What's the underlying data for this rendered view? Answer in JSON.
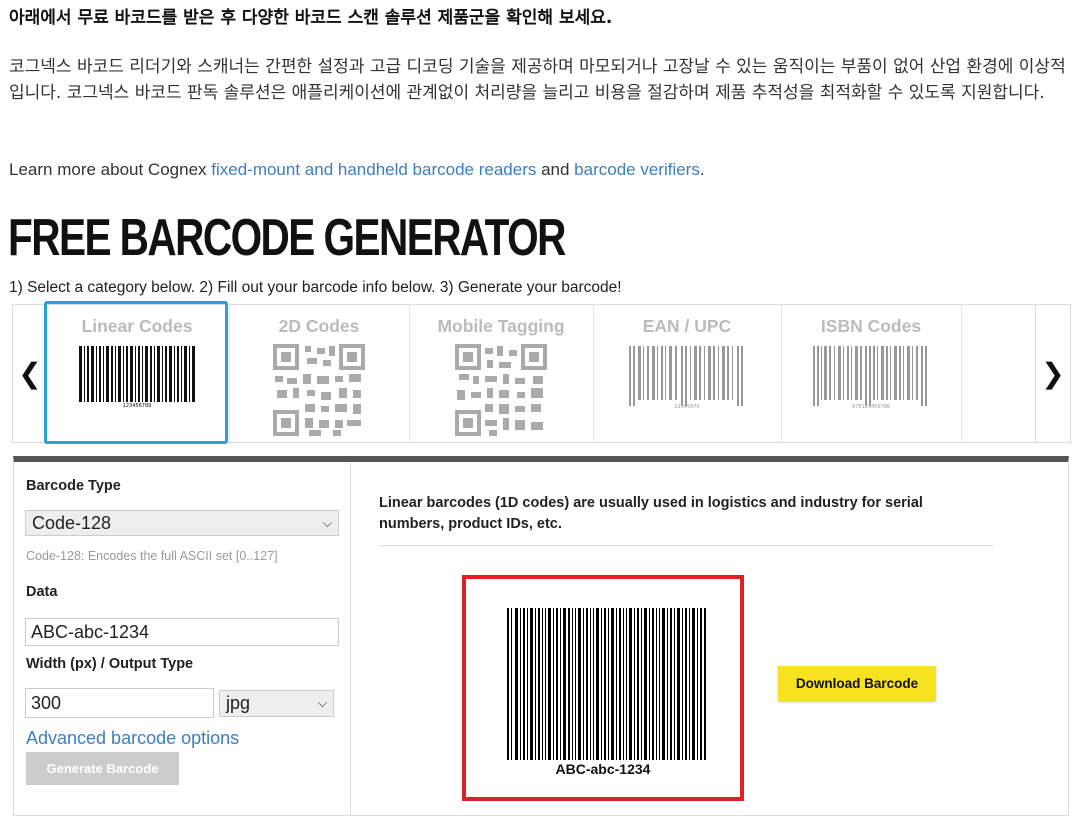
{
  "intro": {
    "heading": "아래에서 무료 바코드를 받은 후 다양한 바코드 스캔 솔루션 제품군을 확인해 보세요.",
    "paragraph": "코그넥스 바코드 리더기와 스캐너는 간편한 설정과 고급 디코딩 기술을 제공하며 마모되거나 고장날 수 있는 움직이는 부품이 없어 산업 환경에 이상적입니다. 코그넥스 바코드 판독 솔루션은 애플리케이션에 관계없이 처리량을 늘리고 비용을 절감하며 제품 추적성을 최적화할 수 있도록 지원합니다.",
    "learn_prefix": "Learn more about Cognex ",
    "learn_link1": "fixed-mount and handheld barcode readers",
    "learn_and": " and ",
    "learn_link2": "barcode verifiers",
    "learn_suffix": "."
  },
  "title": "FREE BARCODE GENERATOR",
  "steps": "1) Select a category below. 2) Fill out your barcode info below. 3) Generate your barcode!",
  "carousel": {
    "prev": "❮",
    "next": "❯",
    "categories": [
      {
        "label": "Linear Codes",
        "caption": "123456789",
        "active": true
      },
      {
        "label": "2D Codes",
        "active": false
      },
      {
        "label": "Mobile Tagging",
        "active": false
      },
      {
        "label": "EAN / UPC",
        "caption": "12345670",
        "active": false
      },
      {
        "label": "ISBN Codes",
        "caption": "978123456786",
        "active": false
      }
    ]
  },
  "form": {
    "barcode_type_label": "Barcode Type",
    "barcode_type_value": "Code-128",
    "barcode_type_hint": "Code-128: Encodes the full ASCII set [0..127]",
    "data_label": "Data",
    "data_value": "ABC-abc-1234",
    "width_label": "Width (px) / Output Type",
    "width_value": "300",
    "output_type_value": "jpg",
    "advanced_link": "Advanced barcode options",
    "generate_button": "Generate Barcode"
  },
  "result": {
    "description": "Linear barcodes (1D codes) are usually used in logistics and industry for serial numbers, product IDs, etc.",
    "barcode_text": "ABC-abc-1234",
    "download_button": "Download Barcode"
  },
  "colors": {
    "link": "#3a7fc0",
    "active_border": "#2aa0d6",
    "result_border": "#e31e24",
    "download_bg": "#f6e21e"
  }
}
